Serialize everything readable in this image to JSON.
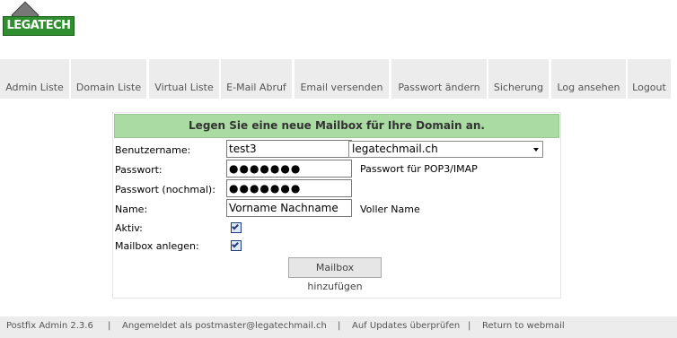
{
  "logo": {
    "text": "LEGATECH"
  },
  "menu": [
    {
      "label": "Admin Liste"
    },
    {
      "label": "Domain Liste"
    },
    {
      "label": "Virtual Liste"
    },
    {
      "label": "E-Mail Abruf"
    },
    {
      "label": "Email versenden"
    },
    {
      "label": "Passwort ändern"
    },
    {
      "label": "Sicherung"
    },
    {
      "label": "Log ansehen"
    },
    {
      "label": "Logout"
    }
  ],
  "form": {
    "title": "Legen Sie eine neue Mailbox für Ihre Domain an.",
    "username_label": "Benutzername:",
    "username_value": "test3",
    "at": "@",
    "domain_value": "legatechmail.ch",
    "password_label": "Passwort:",
    "password_value": "●●●●●●●",
    "password_hint": "Passwort für POP3/IMAP",
    "password2_label": "Passwort (nochmal):",
    "password2_value": "●●●●●●●",
    "name_label": "Name:",
    "name_value": "Vorname Nachname",
    "name_hint": "Voller Name",
    "active_label": "Aktiv:",
    "active_checked": true,
    "create_label": "Mailbox anlegen:",
    "create_checked": true,
    "submit_label": "Mailbox hinzufügen"
  },
  "footer": {
    "version": "Postfix Admin 2.3.6",
    "sep": "|",
    "logged_in": "Angemeldet als postmaster@legatechmail.ch",
    "updates": "Auf Updates überprüfen",
    "webmail": "Return to webmail"
  },
  "colors": {
    "title_bg": "#a9dba2",
    "menu_bg": "#ececec",
    "logo_green": "#2f8f2f"
  }
}
